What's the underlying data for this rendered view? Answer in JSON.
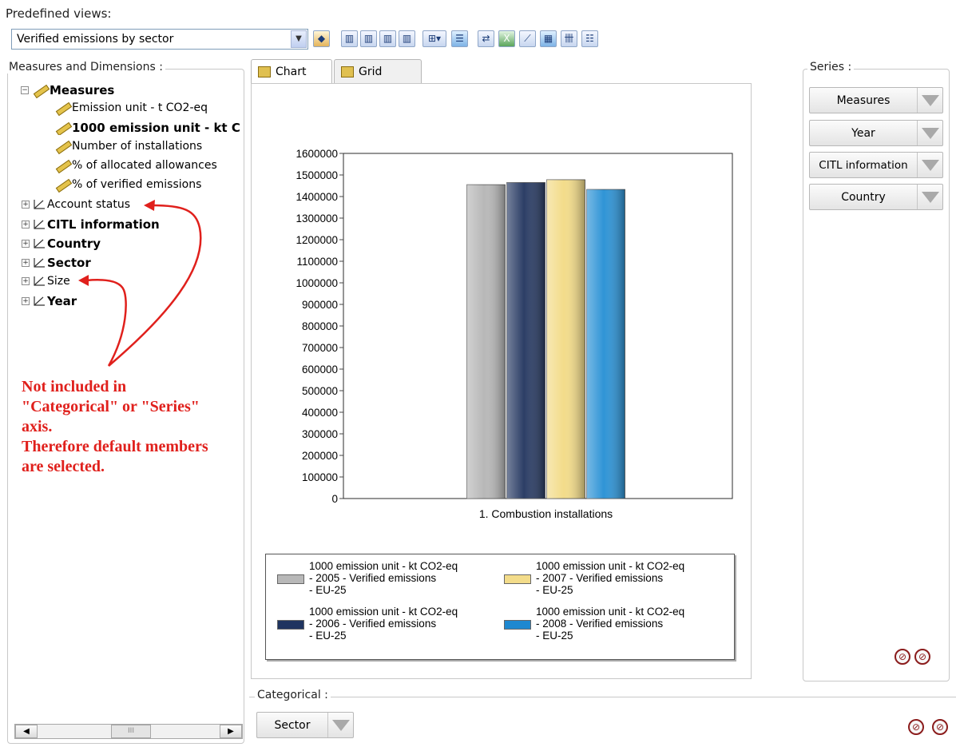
{
  "predefined_views": {
    "label": "Predefined views:",
    "selected": "Verified emissions by sector"
  },
  "toolbar": {
    "icons": [
      "cube-icon",
      "bar-chart-icon",
      "bar-chart-2-icon",
      "bar-chart-3-icon",
      "bar-chart-4-icon",
      "chart-options-icon",
      "list-view-icon",
      "swap-icon",
      "excel-icon",
      "line-icon",
      "filter-icon",
      "grid-icon",
      "tree-icon"
    ]
  },
  "measures_dimensions": {
    "title": "Measures and Dimensions :",
    "measures_label": "Measures",
    "measures": [
      "Emission unit - t CO2-eq",
      "1000 emission unit - kt C",
      "Number of installations",
      "% of allocated allowances",
      "% of verified emissions"
    ],
    "dimensions": [
      "Account status",
      "CITL information",
      "Country",
      "Sector",
      "Size",
      "Year"
    ]
  },
  "annotation": {
    "lines": [
      "Not included in",
      "\"Categorical\" or \"Series\"",
      "axis.",
      "Therefore default members",
      "are selected."
    ]
  },
  "tabs": {
    "chart": "Chart",
    "grid": "Grid"
  },
  "chart_data": {
    "type": "bar",
    "categories": [
      "1. Combustion installations"
    ],
    "series": [
      {
        "name": "1000 emission unit - kt CO2-eq - 2005 - Verified emissions - EU-25",
        "values": [
          1455000
        ],
        "color": "#b8b8b8"
      },
      {
        "name": "1000 emission unit - kt CO2-eq - 2006 - Verified emissions - EU-25",
        "values": [
          1465000
        ],
        "color": "#2c3e66"
      },
      {
        "name": "1000 emission unit - kt CO2-eq - 2007 - Verified emissions - EU-25",
        "values": [
          1478000
        ],
        "color": "#f3dc8a"
      },
      {
        "name": "1000 emission unit - kt CO2-eq - 2008 - Verified emissions - EU-25",
        "values": [
          1433000
        ],
        "color": "#2f94d6"
      }
    ],
    "yticks": [
      "1600000",
      "1500000",
      "1400000",
      "1300000",
      "1200000",
      "1100000",
      "1000000",
      "900000",
      "800000",
      "700000",
      "600000",
      "500000",
      "400000",
      "300000",
      "200000",
      "100000",
      "0"
    ],
    "ylim": [
      0,
      1600000
    ],
    "legend": [
      {
        "lines": [
          "1000 emission unit - kt CO2-eq",
          "- 2005 - Verified emissions",
          "- EU-25"
        ],
        "color": "#b8b8b8"
      },
      {
        "lines": [
          "1000 emission unit - kt CO2-eq",
          "- 2007 - Verified emissions",
          "- EU-25"
        ],
        "color": "#f3dc8a"
      },
      {
        "lines": [
          "1000 emission unit - kt CO2-eq",
          "- 2006 - Verified emissions",
          "- EU-25"
        ],
        "color": "#1f3460"
      },
      {
        "lines": [
          "1000 emission unit - kt CO2-eq",
          "- 2008 - Verified emissions",
          "- EU-25"
        ],
        "color": "#1e88d0"
      }
    ],
    "legend_position": "bottom"
  },
  "series_panel": {
    "title": "Series :",
    "items": [
      "Measures",
      "Year",
      "CITL information",
      "Country"
    ]
  },
  "categorical": {
    "title": "Categorical :",
    "item": "Sector"
  },
  "scrollbar": {
    "thumb": "III"
  }
}
